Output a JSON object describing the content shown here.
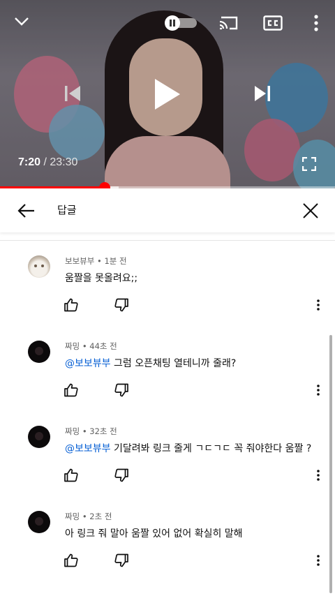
{
  "player": {
    "current_time": "7:20",
    "total_time": " / 23:30",
    "played_fraction": 0.312,
    "buffered_fraction": 0.355,
    "autoplay_on": false,
    "icons": [
      "chevron-down-icon",
      "autoplay-toggle",
      "cast-icon",
      "closed-captions-icon",
      "more-vert-icon",
      "skip-previous-icon",
      "play-icon",
      "skip-next-icon",
      "fullscreen-icon"
    ]
  },
  "replies_panel": {
    "title": "답글",
    "icons": [
      "arrow-back-icon",
      "close-icon"
    ]
  },
  "replies": [
    {
      "author": "보보뷰부",
      "time": "1분 전",
      "mention": "",
      "text": "움짤을 못올려요;;",
      "avatar": "cat"
    },
    {
      "author": "짜밍",
      "time": "44초 전",
      "mention": "@보보뷰부",
      "text": " 그럼 오픈채팅 열테니까 줄래?",
      "avatar": "dark"
    },
    {
      "author": "짜밍",
      "time": "32초 전",
      "mention": "@보보뷰부",
      "text": " 기달려봐 링크 줄게 ㄱㄷㄱㄷ 꼭 줘야한다 움짤 ?",
      "avatar": "dark"
    },
    {
      "author": "짜밍",
      "time": "2초 전",
      "mention": "",
      "text": "아 링크 줘 말아 움짤 있어 없어 확실히 말해",
      "avatar": "dark"
    }
  ],
  "colors": {
    "accent": "#ff0000",
    "mention": "#065fd4",
    "text": "#0f0f0f",
    "meta": "#606060"
  }
}
